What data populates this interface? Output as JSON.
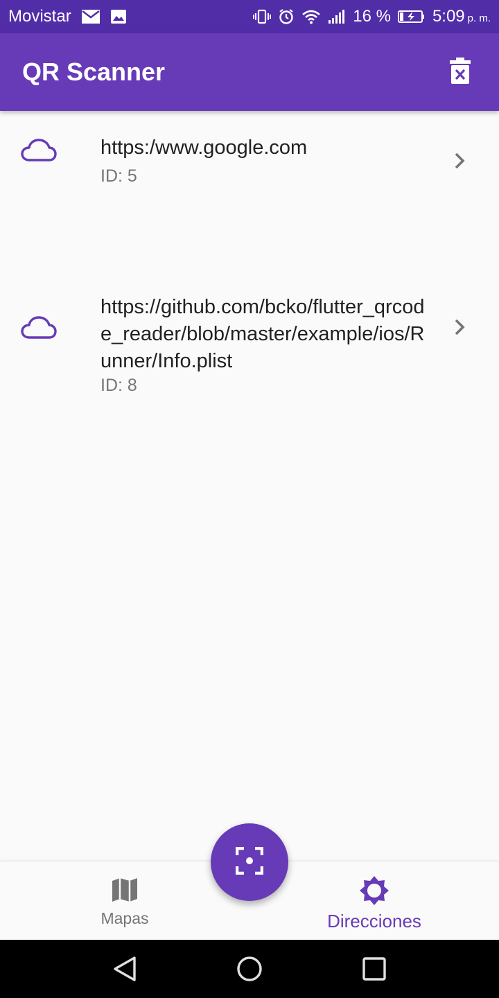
{
  "status_bar": {
    "carrier": "Movistar",
    "battery_percent": "16 %",
    "time": "5:09",
    "time_suffix": "p. m.",
    "icons": [
      "mail-icon",
      "image-icon",
      "vibrate-icon",
      "alarm-icon",
      "wifi-icon",
      "signal-icon",
      "battery-charging-icon"
    ]
  },
  "app_bar": {
    "title": "QR Scanner",
    "action_icon": "delete-sweep-icon"
  },
  "scans": [
    {
      "url": "https:/www.google.com",
      "id_label": "ID: 5",
      "icon": "cloud-icon"
    },
    {
      "url": "https://github.com/bcko/flutter_qrcode_reader/blob/master/example/ios/Runner/Info.plist",
      "id_label": "ID: 8",
      "icon": "cloud-icon"
    }
  ],
  "bottom_nav": {
    "items": [
      {
        "label": "Mapas",
        "icon": "map-icon",
        "selected": false
      },
      {
        "label": "Direcciones",
        "icon": "brightness-icon",
        "selected": true
      }
    ]
  },
  "fab": {
    "icon": "center-focus-icon"
  },
  "colors": {
    "primary": "#673ab7",
    "primary_dark": "#512da8",
    "background": "#fafafa",
    "text_primary": "#212121",
    "text_secondary": "#757575"
  }
}
